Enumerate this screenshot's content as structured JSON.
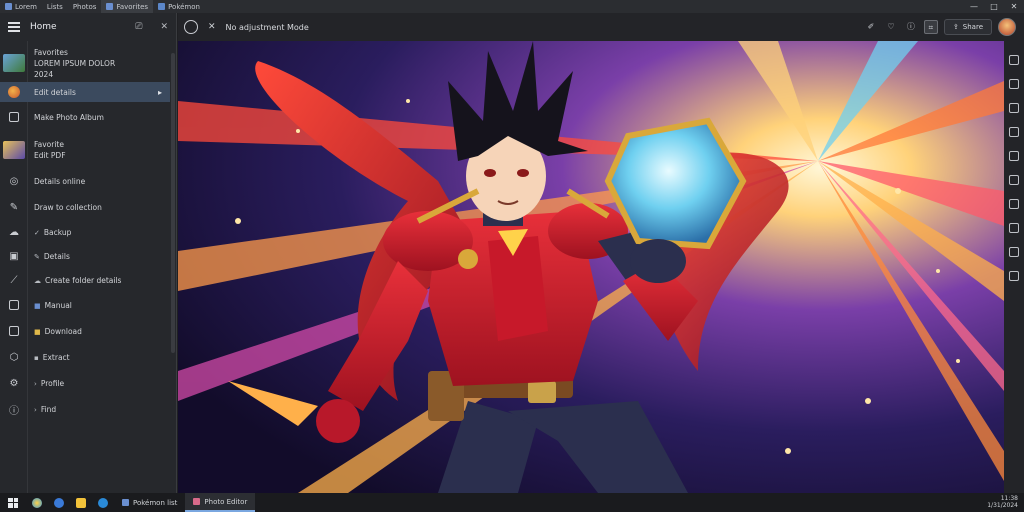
{
  "titlebar": {
    "tabs": [
      {
        "label": "Lorem"
      },
      {
        "label": "Lists"
      },
      {
        "label": "Photos"
      },
      {
        "label": "Favorites"
      },
      {
        "label": "Pokémon"
      }
    ],
    "controls": [
      "—",
      "□",
      "✕"
    ]
  },
  "sidebar": {
    "title": "Home",
    "items": [
      {
        "line1": "Favorites",
        "line2": "LOREM IPSUM DOLOR",
        "line3": "2024"
      },
      {
        "line1": "Edit details"
      },
      {
        "line1": "Make Photo Album"
      },
      {
        "line1": "Favorite",
        "line2": "Edit PDF"
      },
      {
        "line1": "Details online"
      },
      {
        "line1": "Draw to collection"
      },
      {
        "line1": "Backup"
      },
      {
        "line1": "Details"
      },
      {
        "line1": "Create folder details"
      },
      {
        "line1": "Manual"
      },
      {
        "line1": "Download"
      },
      {
        "line1": "Extract"
      },
      {
        "line1": "Profile"
      },
      {
        "line1": "Find"
      }
    ]
  },
  "toolbar": {
    "title": "No adjustment Mode",
    "share_label": "Share"
  },
  "taskbar": {
    "apps": [
      {
        "label": "Pokémon list"
      },
      {
        "label": "Photo Editor"
      }
    ],
    "time": "11:38",
    "date": "1/31/2024"
  },
  "colors": {
    "accent": "#7aa7e0",
    "active_item": "#3b4a5e",
    "hero_red": "#c8202c"
  }
}
